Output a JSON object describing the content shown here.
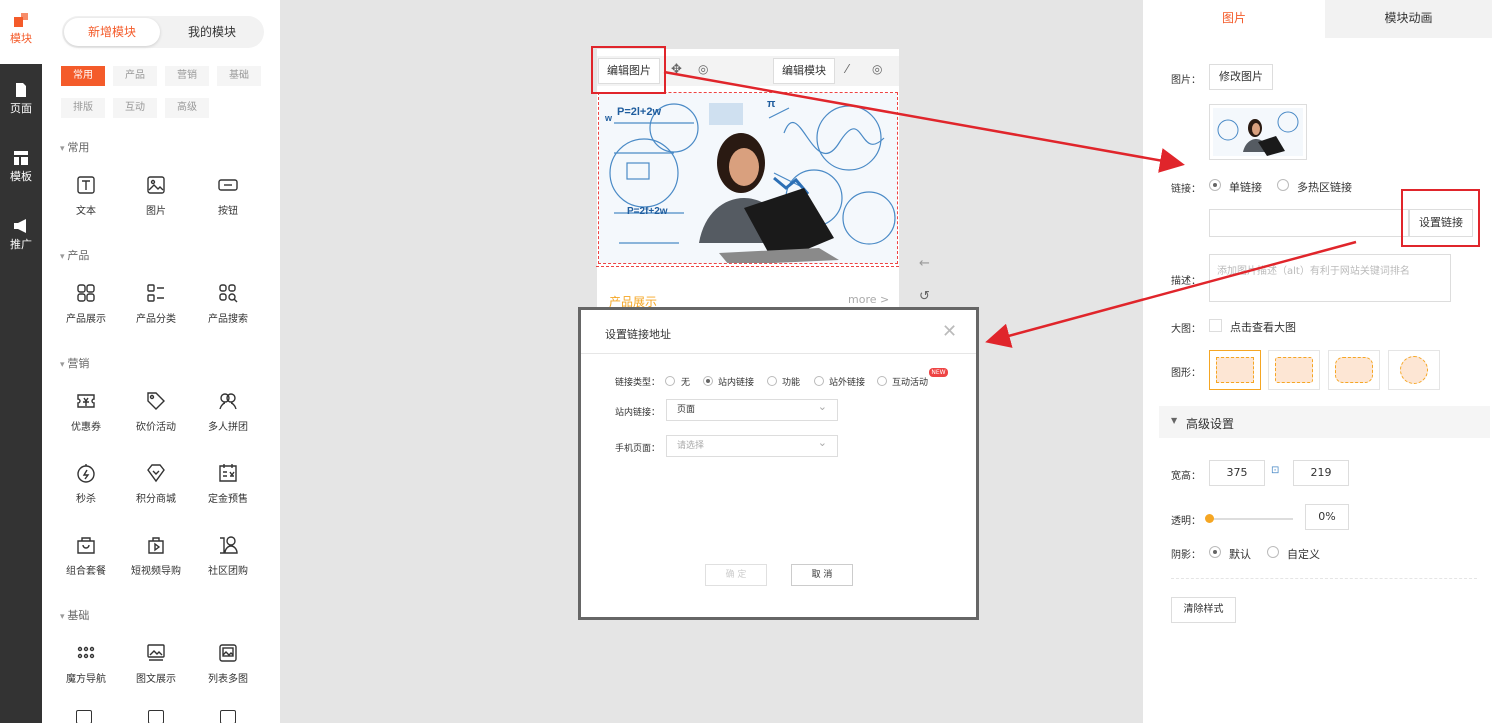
{
  "colors": {
    "accent": "#f45b2a",
    "annotation": "#e0252b",
    "nav_bg": "#333333"
  },
  "nav": [
    {
      "label": "模块",
      "icon": "blocks-icon"
    },
    {
      "label": "页面",
      "icon": "page-icon"
    },
    {
      "label": "模板",
      "icon": "template-icon"
    },
    {
      "label": "推广",
      "icon": "megaphone-icon"
    }
  ],
  "panel": {
    "tabs": [
      "新增模块",
      "我的模块"
    ],
    "chips": [
      "常用",
      "产品",
      "营销",
      "基础",
      "排版",
      "互动",
      "高级"
    ],
    "sections": {
      "common": {
        "title": "常用",
        "items": [
          "文本",
          "图片",
          "按钮"
        ]
      },
      "product": {
        "title": "产品",
        "items": [
          "产品展示",
          "产品分类",
          "产品搜索"
        ]
      },
      "marketing": {
        "title": "营销",
        "items": [
          "优惠券",
          "砍价活动",
          "多人拼团",
          "秒杀",
          "积分商城",
          "定金预售",
          "组合套餐",
          "短视频导购",
          "社区团购"
        ]
      },
      "basic": {
        "title": "基础",
        "items": [
          "魔方导航",
          "图文展示",
          "列表多图"
        ]
      }
    }
  },
  "preview": {
    "edit_image": "编辑图片",
    "edit_module": "编辑模块",
    "product_title": "产品展示",
    "more": "more >",
    "hero_texts": [
      "P=2l+2w",
      "P=2f+2w",
      "π",
      "w"
    ]
  },
  "modal": {
    "title": "设置链接地址",
    "link_type_label": "链接类型：",
    "link_types": [
      "无",
      "站内链接",
      "功能",
      "站外链接",
      "互动活动"
    ],
    "new_badge": "NEW",
    "internal_label": "站内链接：",
    "internal_value": "页面",
    "mobile_label": "手机页面：",
    "mobile_placeholder": "请选择",
    "ok": "确 定",
    "cancel": "取 消"
  },
  "right": {
    "tabs": [
      "图片",
      "模块动画"
    ],
    "image_label": "图片：",
    "change_image": "修改图片",
    "link_label": "链接：",
    "link_options": [
      "单链接",
      "多热区链接"
    ],
    "set_link": "设置链接",
    "desc_label": "描述：",
    "desc_placeholder": "添加图片描述（alt）有利于网站关键词排名",
    "big_label": "大图：",
    "big_text": "点击查看大图",
    "shape_label": "图形：",
    "advanced": "高级设置",
    "size_label": "宽高：",
    "width": "375",
    "height": "219",
    "opacity_label": "透明：",
    "opacity_value": "0%",
    "shadow_label": "阴影：",
    "shadow_options": [
      "默认",
      "自定义"
    ],
    "clear": "清除样式"
  }
}
